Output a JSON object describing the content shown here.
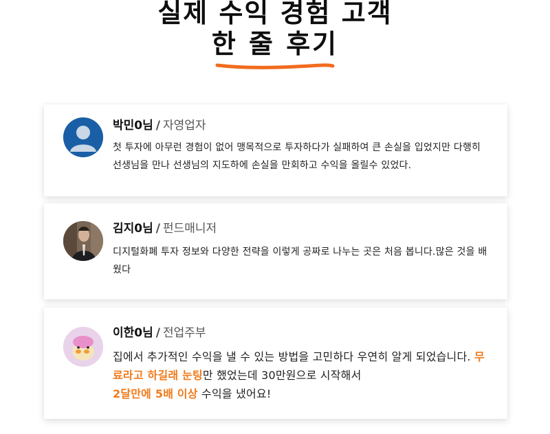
{
  "header": {
    "title_line1": "실제 수익 경험 고객",
    "title_line2": "한 줄 후기",
    "accent_color": "#f26b1d"
  },
  "reviews": [
    {
      "name": "박민0님",
      "role": "자영업자",
      "avatar_icon": "default-user-icon",
      "text": "첫 투자에 아무런 경험이 없어 맹목적으로 투자하다가 실패하여 큰 손실을 입었지만 다행히 선생님을 만나 선생님의 지도하에 손실을 만회하고 수익을 올릴수 있었다."
    },
    {
      "name": "김지0님",
      "role": "펀드매니저",
      "avatar_icon": "man-in-suit-photo",
      "text": "디지털화폐 투자 정보와 다양한 전략을 이렇게 공짜로 나누는 곳은 처음 봅니다.많은 것을 배웠다"
    },
    {
      "name": "이한0님",
      "role": "전업주부",
      "avatar_icon": "duck-toy-photo",
      "text_part1": "집에서 추가적인 수익을 낼 수 있는 방법을 고민하다 우연히 알게 되었습니다. ",
      "highlight1": "무료라고 하길래 눈팅",
      "text_part2": "만 했었는데 30만원으로 시작해서 ",
      "highlight2": "2달만에 5배 이상",
      "text_part3": " 수익을 냈어요!",
      "highlight_color": "#f07a1a"
    }
  ]
}
